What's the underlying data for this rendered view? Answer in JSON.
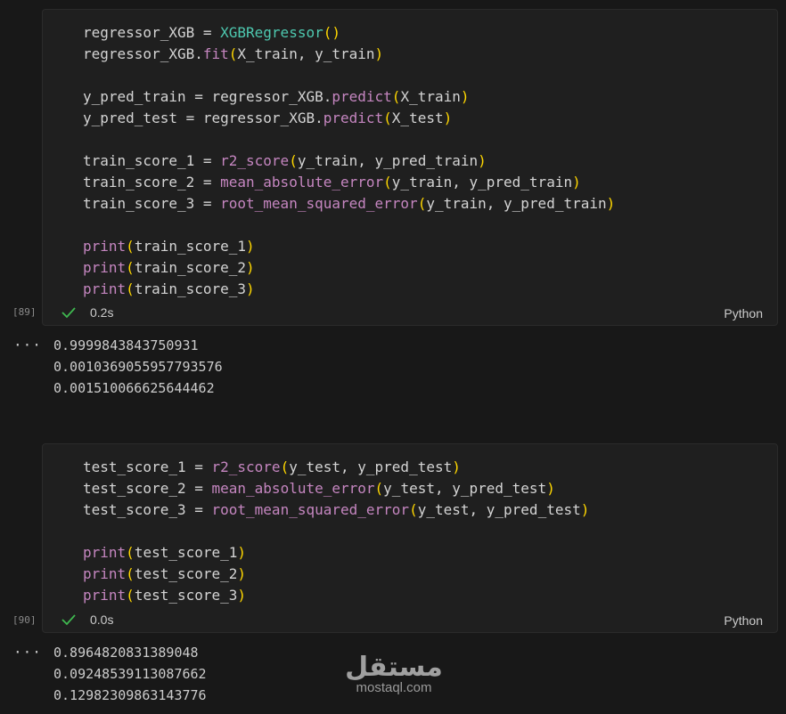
{
  "cells": [
    {
      "exec_count": "[89]",
      "status_time": "0.2s",
      "language": "Python",
      "outputs": [
        "0.9999843843750931",
        "0.0010369055957793576",
        "0.001510066625644462"
      ]
    },
    {
      "exec_count": "[90]",
      "status_time": "0.0s",
      "language": "Python",
      "outputs": [
        "0.8964820831389048",
        "0.09248539113087662",
        "0.12982309863143776"
      ]
    }
  ],
  "output_more": "···",
  "watermark": {
    "logo": "مستقل",
    "text": "mostaql.com"
  },
  "colors": {
    "check": "#3fb950",
    "class": "#4ec9b0",
    "func": "#c586c0",
    "paren": "#ffd700"
  },
  "icons": {
    "check": "check-icon",
    "more": "ellipsis-icon"
  }
}
